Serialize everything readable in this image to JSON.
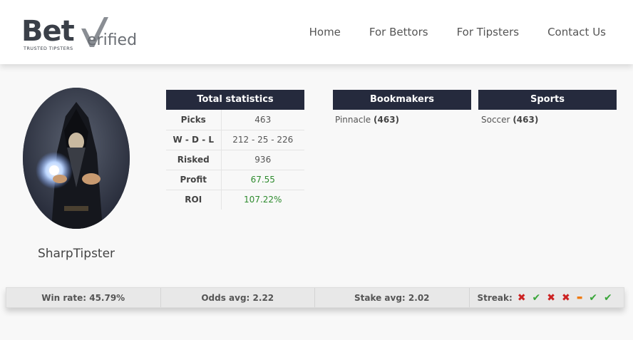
{
  "brand": {
    "word": "Bet",
    "word2": "erified",
    "tagline": "TRUSTED TIPSTERS"
  },
  "nav": [
    "Home",
    "For Bettors",
    "For Tipsters",
    "Contact Us"
  ],
  "profile": {
    "name": "SharpTipster",
    "avatar_icon": "wizard-portrait"
  },
  "total_statistics": {
    "title": "Total statistics",
    "rows": [
      {
        "label": "Picks",
        "value": "463"
      },
      {
        "label": "W - D - L",
        "value": "212 - 25 - 226"
      },
      {
        "label": "Risked",
        "value": "936"
      },
      {
        "label": "Profit",
        "value": "67.55"
      },
      {
        "label": "ROI",
        "value": "107.22%"
      }
    ]
  },
  "bookmakers": {
    "title": "Bookmakers",
    "items": [
      {
        "name": "Pinnacle",
        "count": "(463)"
      }
    ]
  },
  "sports": {
    "title": "Sports",
    "items": [
      {
        "name": "Soccer",
        "count": "(463)"
      }
    ]
  },
  "summary": {
    "win_rate": "Win rate: 45.79%",
    "odds_avg": "Odds avg: 2.22",
    "stake_avg": "Stake avg: 2.02",
    "streak_label": "Streak:",
    "streak": [
      "loss",
      "win",
      "loss",
      "loss",
      "draw",
      "win",
      "win"
    ]
  },
  "colors": {
    "header_dark": "#252a3d",
    "green": "#2e8b2e",
    "loss": "#cc2222",
    "win": "#3aa63a",
    "draw": "#f07a10"
  }
}
